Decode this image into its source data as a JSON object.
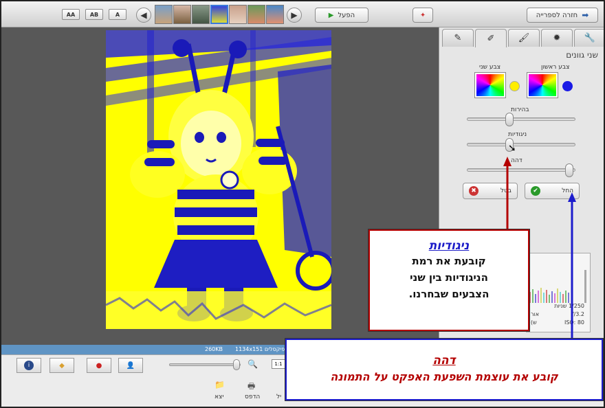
{
  "toolbar": {
    "back_to_library": "חזרה לספרייה",
    "play": "הפעל",
    "view_buttons": [
      "AA",
      "AB",
      "A"
    ]
  },
  "panel": {
    "title": "שני גוונים",
    "first_color_label": "צבע ראשון",
    "second_color_label": "צבע שני",
    "brightness_label": "בהירות",
    "contrast_label": "ניגודיות",
    "fade_label": "דהה",
    "apply_label": "החל",
    "cancel_label": "בטל",
    "sliders": {
      "brightness": 0.38,
      "contrast": 0.38,
      "fade": 0.97
    }
  },
  "info": {
    "shutter_value": "1/250",
    "shutter_label": "שניות",
    "aperture_value": "f/3.2",
    "iso_value": "ISO: 80",
    "partial_a": "אור",
    "partial_b": "(ש"
  },
  "status": {
    "filesize": "260KB",
    "dimensions": "1134x151",
    "pixels_label": "פיקסלים"
  },
  "bottom": {
    "zoom_label": "1:1",
    "print_label": "הדפס",
    "export_label": "יצא",
    "partial_label": "יל"
  },
  "callouts": {
    "contrast_title": "ניגודיות",
    "contrast_line1": "קובעת את רמת",
    "contrast_line2": "הניגודיות בין שני",
    "contrast_line3": "הצבעים שבחרנו.",
    "fade_title": "דהה",
    "fade_text": "קובע את עוצמת השפעת האפקט על התמונה"
  },
  "colors": {
    "first": "#1a1ae6",
    "second": "#ffee00",
    "contrast_arrow": "#b40000",
    "fade_arrow": "#1c1ccc"
  }
}
